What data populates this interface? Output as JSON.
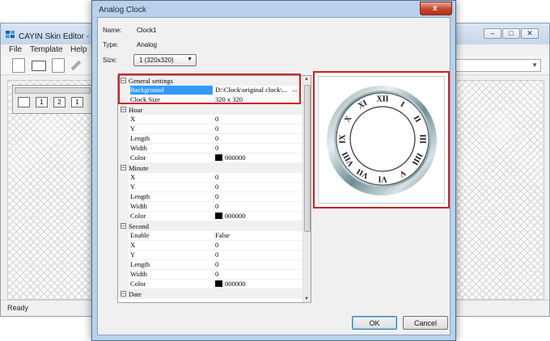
{
  "main_window": {
    "title": "CAYIN Skin Editor - 未",
    "menu": [
      "File",
      "Template",
      "Help"
    ],
    "status": "Ready",
    "controls": {
      "minimize": "–",
      "maximize": "□",
      "close": "✕"
    },
    "mini_toolbar_buttons": [
      "1",
      "2",
      "1"
    ]
  },
  "dialog": {
    "title": "Analog Clock",
    "close_glyph": "x",
    "name_label": "Name:",
    "name_value": "Clock1",
    "type_label": "Type:",
    "type_value": "Analog",
    "size_label": "Size:",
    "size_value": "1  (320x320)",
    "ok_label": "OK",
    "cancel_label": "Cancel"
  },
  "property_grid": {
    "general": {
      "title": "General settings",
      "background_label": "Background",
      "background_value": "D:\\Clock\\original clock\\...",
      "clocksize_label": "Clock Size",
      "clocksize_value": "320 x 320"
    },
    "hour": {
      "title": "Hour",
      "x": "X",
      "x_val": "0",
      "y": "Y",
      "y_val": "0",
      "length": "Length",
      "length_val": "0",
      "width": "Width",
      "width_val": "0",
      "color": "Color",
      "color_val": "000000"
    },
    "minute": {
      "title": "Minute",
      "x": "X",
      "x_val": "0",
      "y": "Y",
      "y_val": "0",
      "length": "Length",
      "length_val": "0",
      "width": "Width",
      "width_val": "0",
      "color": "Color",
      "color_val": "000000"
    },
    "second": {
      "title": "Second",
      "enable": "Enable",
      "enable_val": "False",
      "x": "X",
      "x_val": "0",
      "y": "Y",
      "y_val": "0",
      "length": "Length",
      "length_val": "0",
      "width": "Width",
      "width_val": "0",
      "color": "Color",
      "color_val": "000000"
    },
    "date": {
      "title": "Date"
    },
    "collapse_glyph": "–",
    "ellipsis": "..."
  },
  "clock_numerals": [
    "XII",
    "I",
    "II",
    "III",
    "IIII",
    "V",
    "VI",
    "VII",
    "VIII",
    "IX",
    "X",
    "XI"
  ],
  "colors": {
    "highlight_red": "#cc1f1f",
    "selection_blue": "#3399ff",
    "swatch": "#000000"
  }
}
